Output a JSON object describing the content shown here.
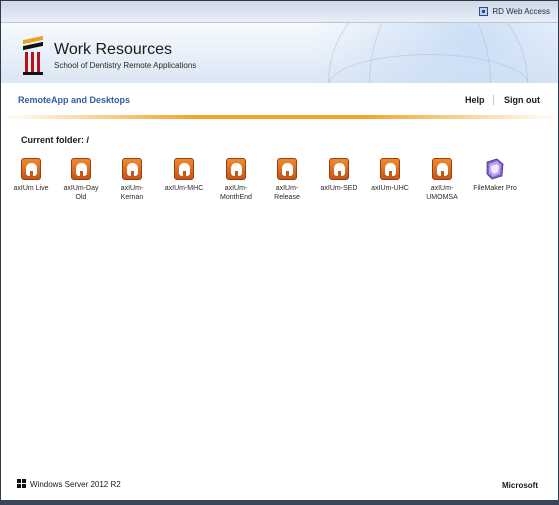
{
  "topbar": {
    "rd_label": "RD Web Access",
    "icon": "rd-web-access-icon"
  },
  "header": {
    "title": "Work Resources",
    "subtitle": "School of Dentistry Remote Applications",
    "logo_icon": "university-logo-icon"
  },
  "nav": {
    "section_label": "RemoteApp and Desktops",
    "help_label": "Help",
    "signout_label": "Sign out"
  },
  "folder": {
    "label": "Current folder: /"
  },
  "apps": [
    {
      "label": "axIUm Live",
      "icon": "tooth-icon"
    },
    {
      "label": "axIUm-Day Old",
      "icon": "tooth-icon"
    },
    {
      "label": "axIUm-Kernan",
      "icon": "tooth-icon"
    },
    {
      "label": "axIUm-MHC",
      "icon": "tooth-icon"
    },
    {
      "label": "axIUm-MonthEnd",
      "icon": "tooth-icon"
    },
    {
      "label": "axIUm-Release",
      "icon": "tooth-icon"
    },
    {
      "label": "axIUm-SED",
      "icon": "tooth-icon"
    },
    {
      "label": "axIUm-UHC",
      "icon": "tooth-icon"
    },
    {
      "label": "axIUm-UMOMSA",
      "icon": "tooth-icon"
    },
    {
      "label": "FileMaker Pro",
      "icon": "filemaker-icon"
    }
  ],
  "footer": {
    "windows_label": "Windows Server 2012 R2",
    "microsoft_label": "Microsoft"
  },
  "colors": {
    "accent_orange": "#f2a42b",
    "link_blue": "#2f5da5"
  }
}
